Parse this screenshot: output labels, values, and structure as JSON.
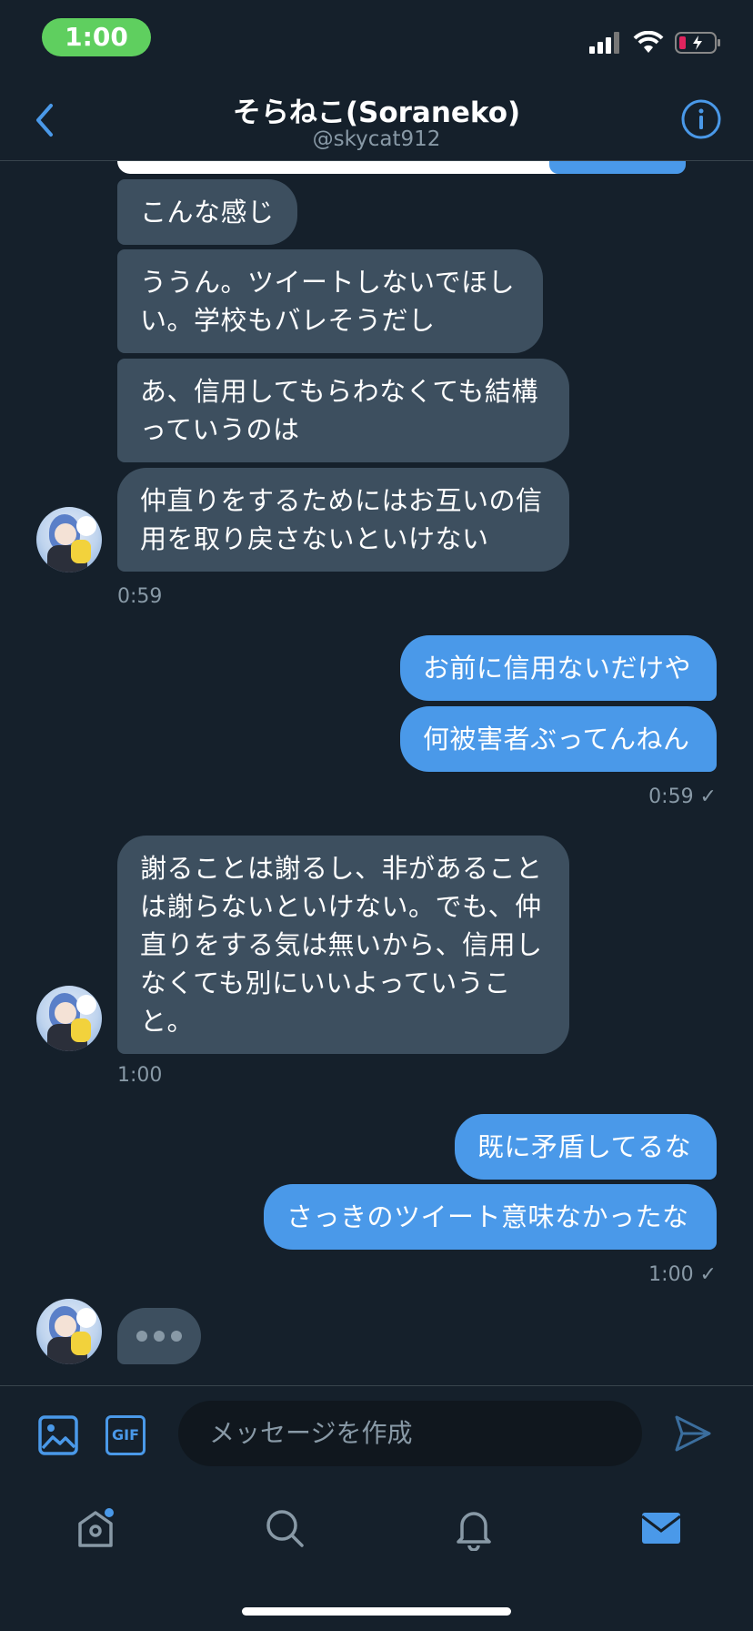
{
  "status_bar": {
    "time": "1:00"
  },
  "header": {
    "title": "そらねこ(Soraneko)",
    "handle": "@skycat912"
  },
  "messages": [
    {
      "text": "こんな感じ"
    },
    {
      "text": "ううん。ツイートしないでほしい。学校もバレそうだし"
    },
    {
      "text": "あ、信用してもらわなくても結構っていうのは"
    },
    {
      "text": "仲直りをするためにはお互いの信用を取り戻さないといけない"
    },
    {
      "time": "0:59"
    },
    {
      "text": "お前に信用ないだけや"
    },
    {
      "text": "何被害者ぶってんねん"
    },
    {
      "time": "0:59 ✓"
    },
    {
      "text": "謝ることは謝るし、非があることは謝らないといけない。でも、仲直りをする気は無いから、信用しなくても別にいいよっていうこと。"
    },
    {
      "time": "1:00"
    },
    {
      "text": "既に矛盾してるな"
    },
    {
      "text": "さっきのツイート意味なかったな"
    },
    {
      "time": "1:00 ✓"
    }
  ],
  "composer": {
    "placeholder": "メッセージを作成",
    "gif_label": "GIF"
  },
  "icons": {
    "back": "chevron-left-icon",
    "info": "info-icon",
    "image": "image-icon",
    "gif": "gif-icon",
    "send": "send-icon",
    "home": "home-icon",
    "search": "search-icon",
    "notifications": "bell-icon",
    "messages": "mail-icon"
  },
  "colors": {
    "background": "#15202b",
    "accent": "#4a99e9",
    "incoming_bubble": "#3d4f5f",
    "battery_low": "#e0245e"
  }
}
